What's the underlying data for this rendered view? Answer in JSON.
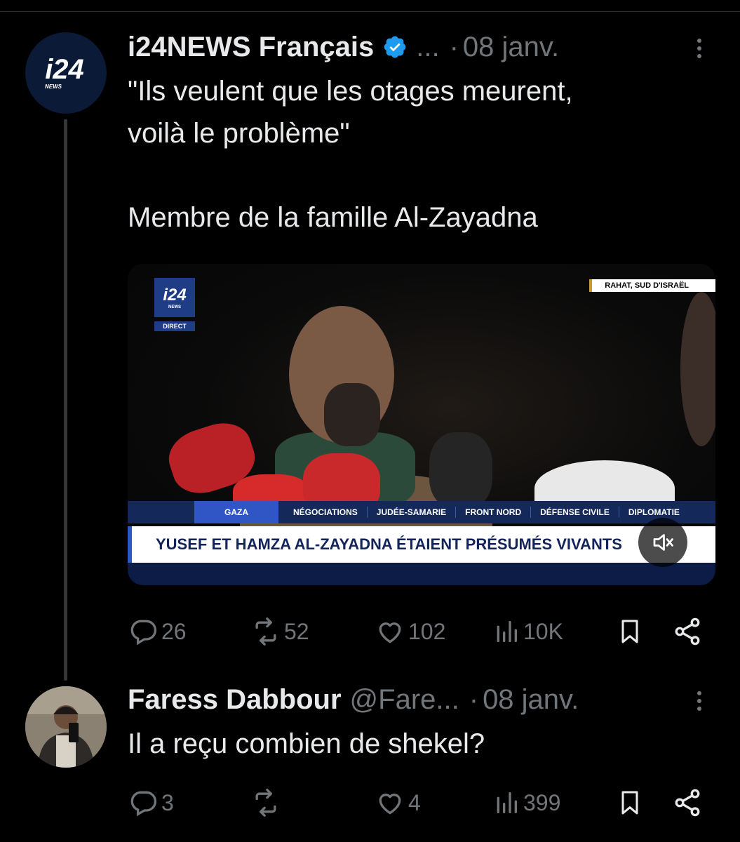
{
  "tweet1": {
    "author_name": "i24NEWS Français",
    "handle": "...",
    "date": "08 janv.",
    "text": "\"Ils veulent que les otages meurent,\nvoilà le problème\"\n\nMembre de la famille Al-Zayadna",
    "avatar_text": "i24",
    "avatar_subtext": "NEWS",
    "media": {
      "logo": "i24",
      "logo_sub": "NEWS",
      "live_label": "DIRECT",
      "location": "RAHAT, SUD D'ISRAËL",
      "nav_active": "GAZA",
      "nav_items": [
        "NÉGOCIATIONS",
        "JUDÉE-SAMARIE",
        "FRONT NORD",
        "DÉFENSE CIVILE",
        "DIPLOMATIE"
      ],
      "headline": "YUSEF ET HAMZA AL-ZAYADNA ÉTAIENT PRÉSUMÉS VIVANTS"
    },
    "replies": "26",
    "reposts": "52",
    "likes": "102",
    "views": "10K"
  },
  "tweet2": {
    "author_name": "Faress Dabbour",
    "handle": "@Fare...",
    "date": "08 janv.",
    "text": "Il a reçu combien de shekel?",
    "replies": "3",
    "reposts": "",
    "likes": "4",
    "views": "399"
  },
  "separator": "·",
  "colors": {
    "background": "#000000",
    "text": "#e7e9ea",
    "muted": "#71767b",
    "verified": "#1d9bf0"
  }
}
